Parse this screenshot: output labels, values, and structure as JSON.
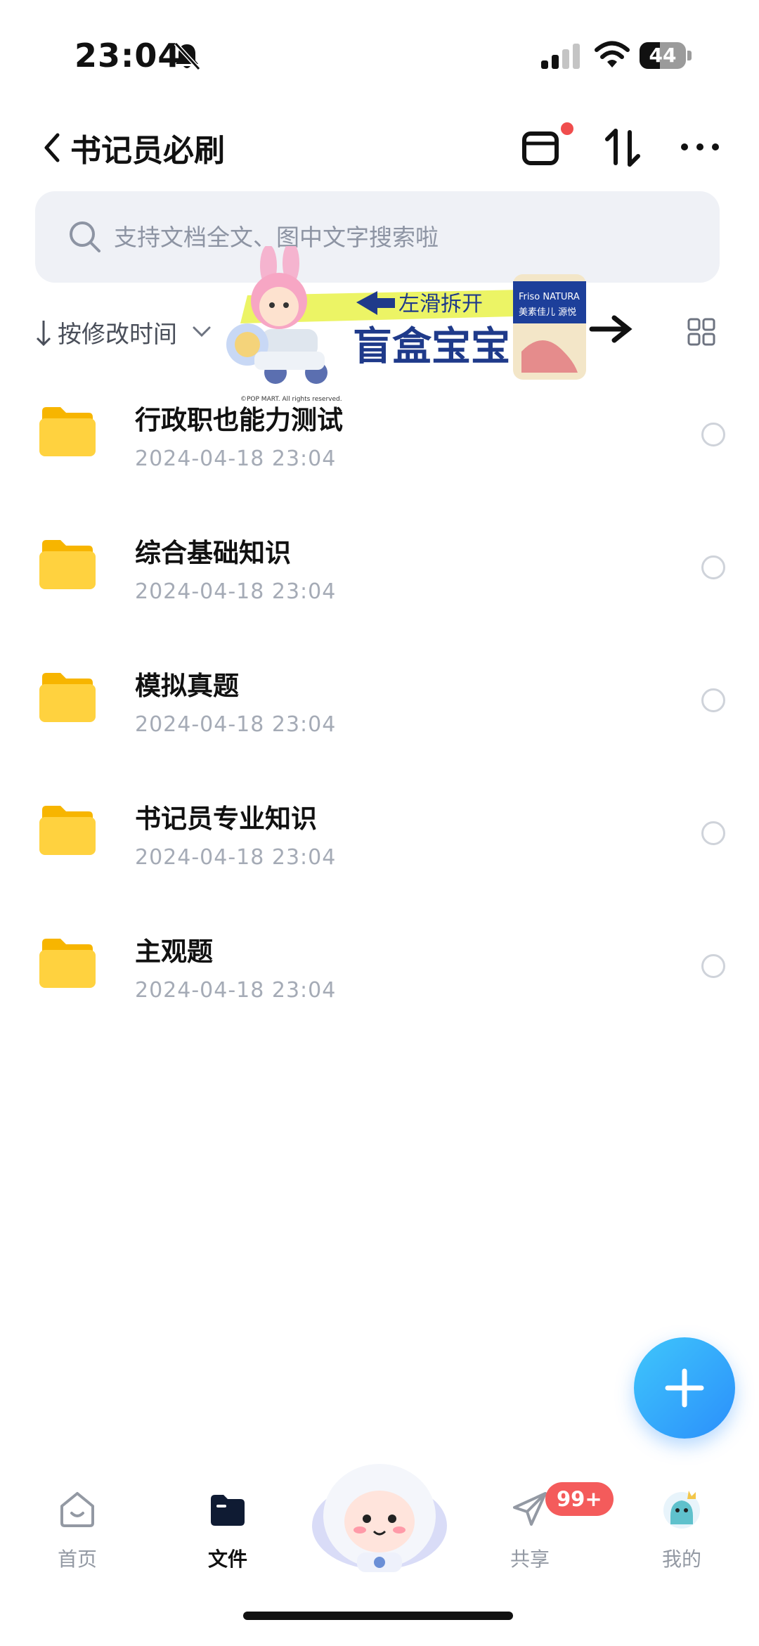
{
  "status_bar": {
    "time": "23:04",
    "battery": "44",
    "battery_level": 0.44,
    "icons": [
      "bell-muted-icon",
      "cellular-signal-icon",
      "wifi-icon",
      "battery-icon"
    ]
  },
  "header": {
    "title": "书记员必刷",
    "icons": [
      "back-chevron-icon",
      "inbox-icon",
      "sort-toggle-icon",
      "more-icon"
    ],
    "notification_dot_color": "#f04d4d"
  },
  "search": {
    "placeholder": "支持文档全文、图中文字搜索啦"
  },
  "sort": {
    "label": "按修改时间"
  },
  "ad": {
    "hint": "左滑拆开",
    "title": "盲盒宝宝",
    "product_brand": "Friso NATURA",
    "product_name": "美素佳儿 源悦",
    "copyright": "©POP MART. All rights reserved."
  },
  "files": [
    {
      "name": "行政职也能力测试",
      "date": "2024-04-18 23:04"
    },
    {
      "name": "综合基础知识",
      "date": "2024-04-18 23:04"
    },
    {
      "name": "模拟真题",
      "date": "2024-04-18 23:04"
    },
    {
      "name": "书记员专业知识",
      "date": "2024-04-18 23:04"
    },
    {
      "name": "主观题",
      "date": "2024-04-18 23:04"
    }
  ],
  "fab": {
    "icon": "plus-icon",
    "color": "#2b8ffb"
  },
  "nav": {
    "home": "首页",
    "files": "文件",
    "share": "共享",
    "share_badge": "99+",
    "mine": "我的"
  },
  "colors": {
    "accent": "#2b8ffb",
    "folder": "#ffc72c",
    "badge": "#f45b5b"
  }
}
